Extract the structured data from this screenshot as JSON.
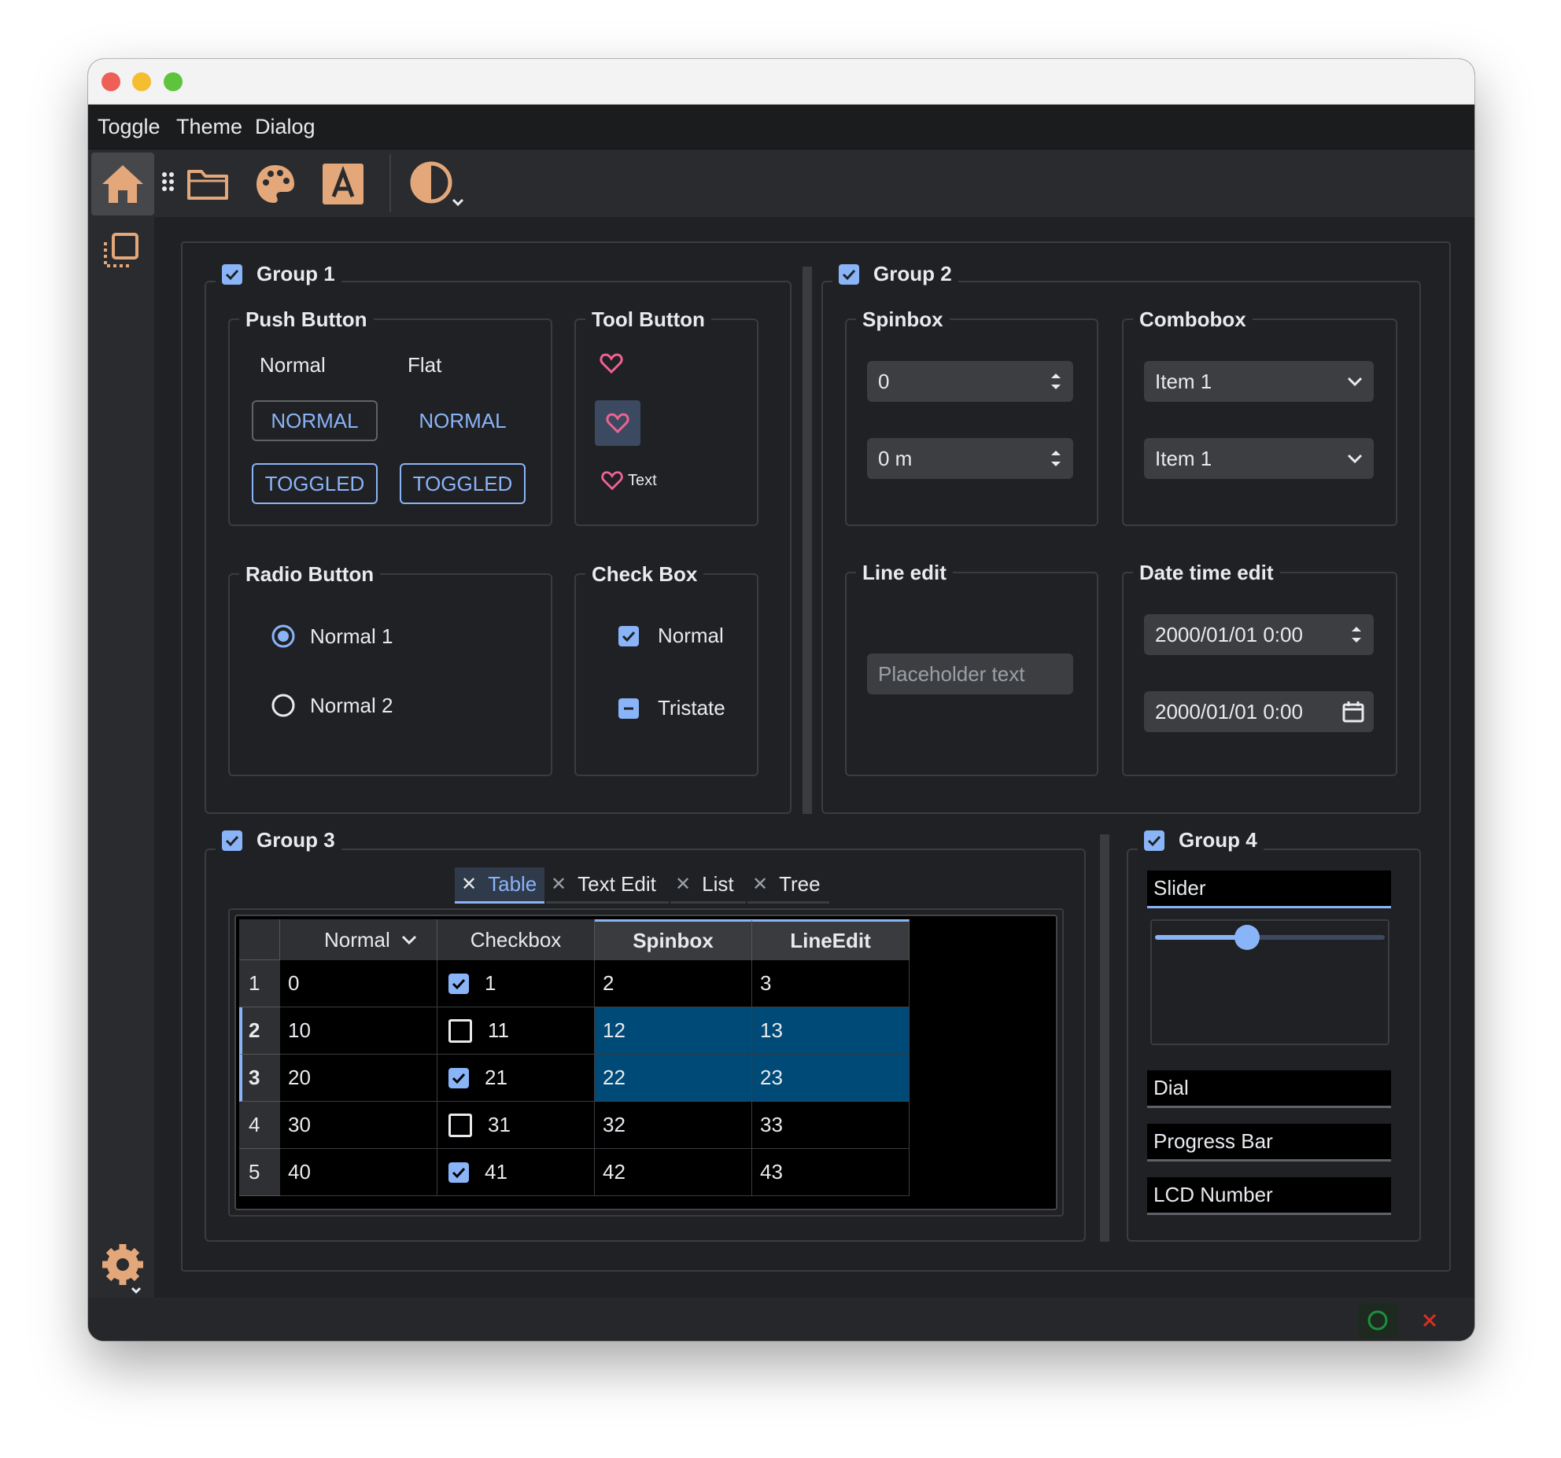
{
  "menu": {
    "toggle": "Toggle",
    "theme": "Theme",
    "dialog": "Dialog"
  },
  "colors": {
    "accent": "#8ab4f8",
    "icon": "#e3a77a",
    "heart": "#f06292",
    "selection": "#004a77"
  },
  "group1": {
    "title": "Group 1",
    "push_button": {
      "title": "Push Button",
      "col_normal": "Normal",
      "col_flat": "Flat",
      "normal_label": "NORMAL",
      "flat_label": "NORMAL",
      "toggled_label": "TOGGLED",
      "toggled_flat_label": "TOGGLED"
    },
    "tool_button": {
      "title": "Tool Button",
      "text": "Text"
    },
    "radio_button": {
      "title": "Radio Button",
      "option1": "Normal 1",
      "option2": "Normal 2"
    },
    "check_box": {
      "title": "Check Box",
      "normal": "Normal",
      "tristate": "Tristate"
    }
  },
  "group2": {
    "title": "Group 2",
    "spinbox": {
      "title": "Spinbox",
      "value1": "0",
      "value2": "0 m"
    },
    "combobox": {
      "title": "Combobox",
      "value1": "Item 1",
      "value2": "Item 1"
    },
    "line_edit": {
      "title": "Line edit",
      "placeholder": "Placeholder text"
    },
    "date_time_edit": {
      "title": "Date time edit",
      "value1": "2000/01/01 0:00",
      "value2": "2000/01/01 0:00"
    }
  },
  "group3": {
    "title": "Group 3",
    "tabs": [
      "Table",
      "Text Edit",
      "List",
      "Tree"
    ],
    "table": {
      "headers": [
        "Normal",
        "Checkbox",
        "Spinbox",
        "LineEdit"
      ],
      "rows": [
        {
          "label": "1",
          "normal": "0",
          "checked": true,
          "checkbox": "1",
          "spinbox": "2",
          "lineedit": "3",
          "selected": false
        },
        {
          "label": "2",
          "normal": "10",
          "checked": false,
          "checkbox": "11",
          "spinbox": "12",
          "lineedit": "13",
          "selected": true
        },
        {
          "label": "3",
          "normal": "20",
          "checked": true,
          "checkbox": "21",
          "spinbox": "22",
          "lineedit": "23",
          "selected": true
        },
        {
          "label": "4",
          "normal": "30",
          "checked": false,
          "checkbox": "31",
          "spinbox": "32",
          "lineedit": "33",
          "selected": false
        },
        {
          "label": "5",
          "normal": "40",
          "checked": true,
          "checkbox": "41",
          "spinbox": "42",
          "lineedit": "43",
          "selected": false
        }
      ]
    }
  },
  "group4": {
    "title": "Group 4",
    "items": [
      "Slider",
      "Dial",
      "Progress Bar",
      "LCD Number"
    ],
    "slider_value": 0.5
  }
}
